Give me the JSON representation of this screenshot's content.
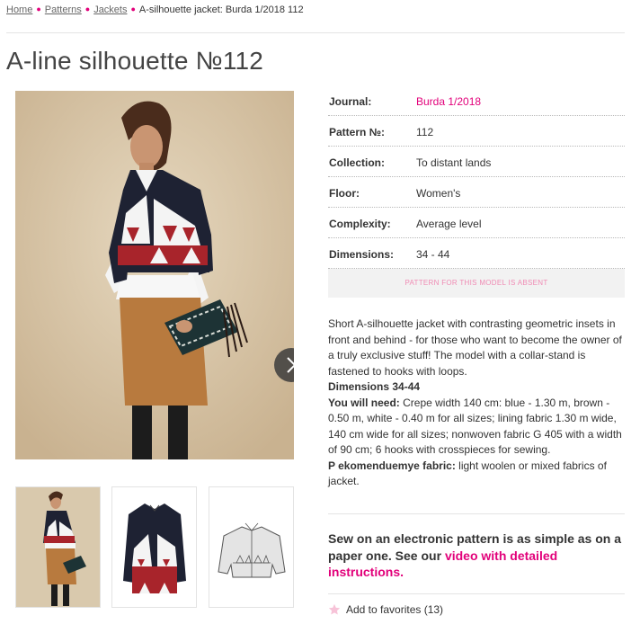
{
  "breadcrumb": {
    "items": [
      "Home",
      "Patterns",
      "Jackets"
    ],
    "current": "A-silhouette jacket: Burda 1/2018 112"
  },
  "title": "A-line silhouette №112",
  "details": [
    {
      "label": "Journal:",
      "value": "Burda 1/2018"
    },
    {
      "label": "Pattern №:",
      "value": "112"
    },
    {
      "label": "Collection:",
      "value": "To distant lands"
    },
    {
      "label": "Floor:",
      "value": "Women's"
    },
    {
      "label": "Complexity:",
      "value": "Average level"
    },
    {
      "label": "Dimensions:",
      "value": "34 - 44"
    }
  ],
  "absent_notice": "PATTERN FOR THIS MODEL IS ABSENT",
  "description": {
    "intro": "Short A-silhouette jacket with contrasting geometric insets in front and behind - for those who want to become the owner of a truly exclusive stuff! The model with a collar-stand is fastened to hooks with loops.",
    "dimensions": "Dimensions 34-44",
    "need_label": "You will need:",
    "need_text": " Crepe width 140 cm: blue - 1.30 m, brown - 0.50 m, white - 0.40 m for all sizes; lining fabric 1.30 m wide, 140 cm wide for all sizes; nonwoven fabric G 405 with a width of 90 cm; 6 hooks with crosspieces for sewing.",
    "fabric_label": "P ekomenduemye fabric:",
    "fabric_text": " light woolen or mixed fabrics of jacket."
  },
  "promo": {
    "text": "Sew on an electronic pattern is as simple as on a paper one. See our ",
    "link": "video with detailed instructions."
  },
  "favorites": "Add to favorites (13)",
  "colors": {
    "accent": "#e2007a",
    "navy": "#1e2233",
    "red": "#a8242b",
    "skirt": "#b87a3e",
    "bg_photo": "#d8c7ab"
  },
  "icons": [
    "chevron-right-icon",
    "star-icon"
  ]
}
